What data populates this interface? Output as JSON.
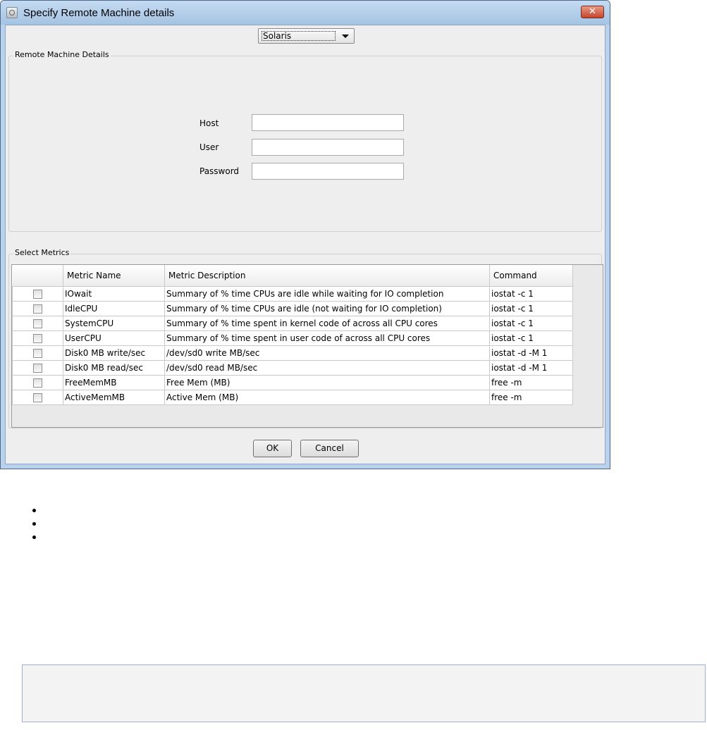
{
  "window": {
    "title": "Specify Remote Machine details",
    "close_glyph": "✕"
  },
  "os_select": {
    "value": "Solaris"
  },
  "remote_group": {
    "legend": "Remote Machine Details",
    "host_label": "Host",
    "user_label": "User",
    "password_label": "Password",
    "host_value": "",
    "user_value": "",
    "password_value": ""
  },
  "metrics_group": {
    "legend": "Select Metrics",
    "columns": [
      "",
      "Metric Name",
      "Metric Description",
      "Command"
    ],
    "rows": [
      {
        "checked": false,
        "name": "IOwait",
        "description": "Summary of % time CPUs are idle while waiting for IO completion",
        "command": "iostat -c 1"
      },
      {
        "checked": false,
        "name": "IdleCPU",
        "description": "Summary of % time CPUs are idle (not waiting for IO completion)",
        "command": "iostat -c 1"
      },
      {
        "checked": false,
        "name": "SystemCPU",
        "description": "Summary of % time spent in kernel code of across all CPU cores",
        "command": "iostat -c 1"
      },
      {
        "checked": false,
        "name": "UserCPU",
        "description": "Summary of % time spent in user code of across all CPU cores",
        "command": "iostat -c 1"
      },
      {
        "checked": false,
        "name": "Disk0 MB write/sec",
        "description": "/dev/sd0 write MB/sec",
        "command": "iostat -d -M 1"
      },
      {
        "checked": false,
        "name": "Disk0 MB read/sec",
        "description": "/dev/sd0 read MB/sec",
        "command": "iostat -d -M 1"
      },
      {
        "checked": false,
        "name": "FreeMemMB",
        "description": "Free Mem (MB)",
        "command": "free -m"
      },
      {
        "checked": false,
        "name": "ActiveMemMB",
        "description": "Active Mem (MB)",
        "command": "free -m"
      }
    ]
  },
  "buttons": {
    "ok": "OK",
    "cancel": "Cancel"
  },
  "bullets": [
    "",
    "",
    ""
  ],
  "colors": {
    "titlebar": "#b9d1ea",
    "client": "#eeeeee",
    "close": "#c5452c"
  }
}
